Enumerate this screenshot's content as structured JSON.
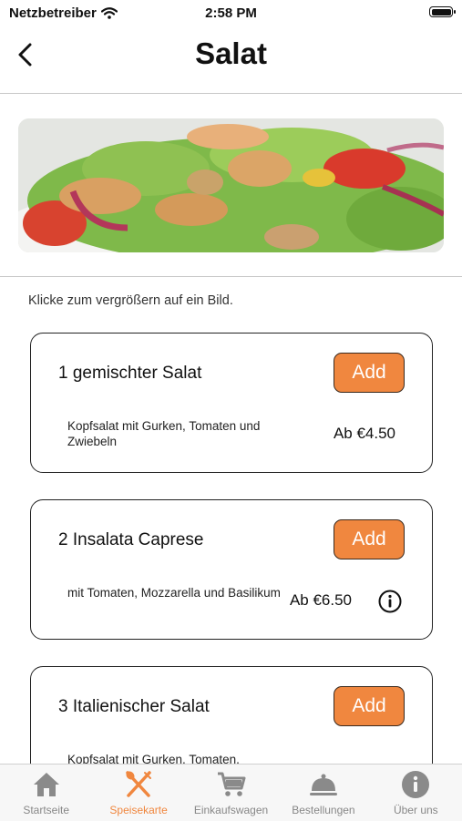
{
  "status_bar": {
    "carrier": "Netzbetreiber",
    "time": "2:58 PM"
  },
  "nav": {
    "title": "Salat",
    "back_icon": "chevron-left-icon"
  },
  "hint": "Klicke zum vergrößern auf ein Bild.",
  "items": [
    {
      "name": "1 gemischter Salat",
      "description": "Kopfsalat mit Gurken, Tomaten und Zwiebeln",
      "price": "Ab €4.50",
      "add_label": "Add",
      "has_info": false
    },
    {
      "name": "2 Insalata Caprese",
      "description": "mit Tomaten, Mozzarella und Basilikum",
      "price": "Ab €6.50",
      "add_label": "Add",
      "has_info": true
    },
    {
      "name": "3 Italienischer Salat",
      "description": "Kopfsalat mit Gurken, Tomaten,",
      "price": "",
      "add_label": "Add",
      "has_info": false
    }
  ],
  "tabs": [
    {
      "label": "Startseite",
      "icon": "home-icon",
      "active": false
    },
    {
      "label": "Speisekarte",
      "icon": "fork-knife-icon",
      "active": true
    },
    {
      "label": "Einkaufswagen",
      "icon": "cart-icon",
      "active": false
    },
    {
      "label": "Bestellungen",
      "icon": "cloche-icon",
      "active": false
    },
    {
      "label": "Über uns",
      "icon": "info-icon",
      "active": false
    }
  ],
  "colors": {
    "accent": "#f0873f",
    "inactive": "#888888",
    "border": "#222222"
  }
}
